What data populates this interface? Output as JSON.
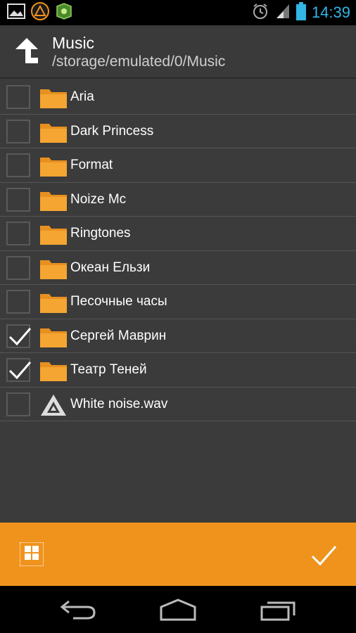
{
  "status_bar": {
    "time": "14:39",
    "left_icons": [
      "gallery-icon",
      "aimp-icon",
      "game-icon"
    ],
    "right_icons": [
      "alarm-icon",
      "signal-icon",
      "battery-icon"
    ]
  },
  "header": {
    "title": "Music",
    "path": "/storage/emulated/0/Music"
  },
  "items": [
    {
      "name": "Aria",
      "type": "folder",
      "checked": false
    },
    {
      "name": "Dark Princess",
      "type": "folder",
      "checked": false
    },
    {
      "name": "Format",
      "type": "folder",
      "checked": false
    },
    {
      "name": "Noize Mc",
      "type": "folder",
      "checked": false
    },
    {
      "name": "Ringtones",
      "type": "folder",
      "checked": false
    },
    {
      "name": "Океан Ельзи",
      "type": "folder",
      "checked": false
    },
    {
      "name": "Песочные часы",
      "type": "folder",
      "checked": false
    },
    {
      "name": "Сергей Маврин",
      "type": "folder",
      "checked": true
    },
    {
      "name": "Театр Теней",
      "type": "folder",
      "checked": true
    },
    {
      "name": "White noise.wav",
      "type": "file",
      "checked": false
    }
  ],
  "colors": {
    "accent": "#f0931d",
    "folder": "#e8901f",
    "clock": "#33b5e5"
  },
  "nav": [
    "back-icon",
    "home-icon",
    "recent-apps-icon"
  ]
}
